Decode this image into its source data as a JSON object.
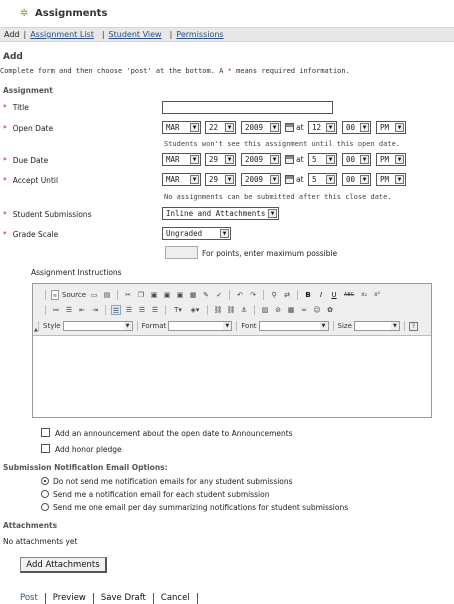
{
  "header": {
    "title": "Assignments"
  },
  "nav": {
    "current": "Add",
    "links": [
      "Assignment List",
      "Student View",
      "Permissions"
    ]
  },
  "page": {
    "heading": "Add",
    "instructions_pre": "Complete form and then choose 'post' at the bottom. A",
    "required_mark": "*",
    "instructions_post": "means required information.",
    "section_assignment": "Assignment"
  },
  "form": {
    "title_label": "Title",
    "title_value": "",
    "open_date": {
      "label": "Open Date",
      "month": "MAR",
      "day": "22",
      "year": "2009",
      "at": "at",
      "hour": "12",
      "minute": "00",
      "ampm": "PM",
      "note": "Students won't see this assignment until this open date."
    },
    "due_date": {
      "label": "Due Date",
      "month": "MAR",
      "day": "29",
      "year": "2009",
      "at": "at",
      "hour": "5",
      "minute": "00",
      "ampm": "PM"
    },
    "accept_until": {
      "label": "Accept Until",
      "month": "MAR",
      "day": "29",
      "year": "2009",
      "at": "at",
      "hour": "5",
      "minute": "00",
      "ampm": "PM",
      "note": "No assignments can be submitted after this close date."
    },
    "student_submissions": {
      "label": "Student Submissions",
      "value": "Inline and Attachments"
    },
    "grade_scale": {
      "label": "Grade Scale",
      "value": "Ungraded",
      "points_hint": "For points, enter maximum possible"
    }
  },
  "editor": {
    "label": "Assignment Instructions",
    "source_label": "Source",
    "style_label": "Style",
    "format_label": "Format",
    "font_label": "Font",
    "size_label": "Size",
    "bold_label": "B",
    "italic_label": "I",
    "underline_label": "U",
    "strike_label": "ABC",
    "sub_label": "x₂",
    "sup_label": "x²",
    "help_label": "?"
  },
  "options": {
    "announcement": "Add an announcement about the open date to Announcements",
    "honor_pledge": "Add honor pledge"
  },
  "notifications": {
    "heading": "Submission Notification Email Options:",
    "options": [
      "Do not send me notification emails for any student submissions",
      "Send me a notification email for each student submission",
      "Send me one email per day summarizing notifications for student submissions"
    ],
    "selected": 0
  },
  "attachments": {
    "heading": "Attachments",
    "status": "No attachments yet",
    "button": "Add Attachments"
  },
  "actions": [
    "Post",
    "Preview",
    "Save Draft",
    "Cancel"
  ],
  "colors": {
    "link": "#2a4f8a",
    "required": "#cc2222",
    "nav_bg": "#e8e8e8"
  }
}
